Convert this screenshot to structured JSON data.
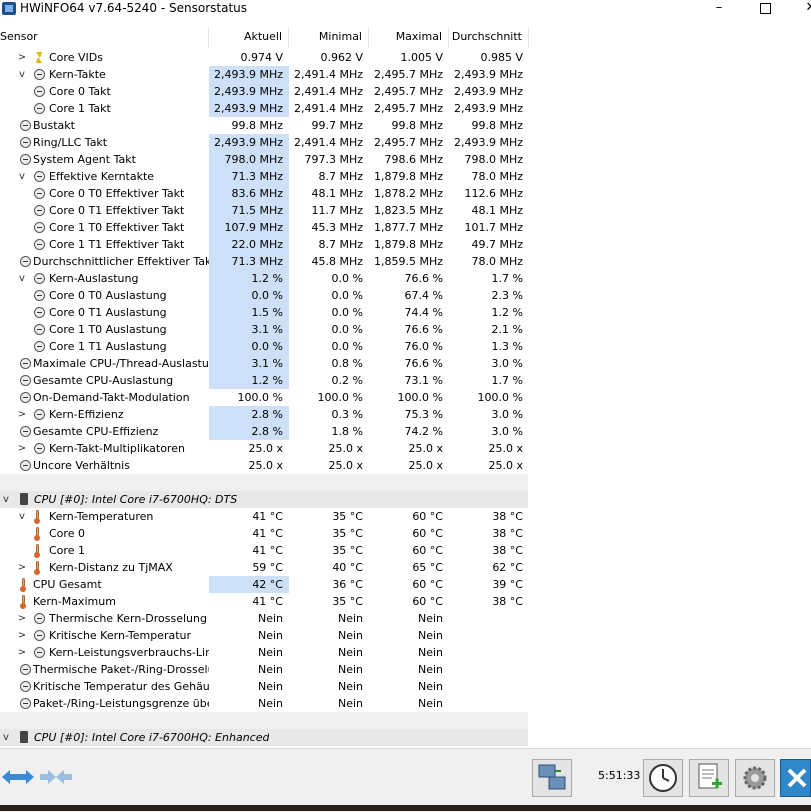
{
  "window": {
    "title": "HWiNFO64 v7.64-5240 - Sensorstatus",
    "controls": [
      "–",
      "□",
      "✕"
    ]
  },
  "header": {
    "sensor": "Sensor",
    "current": "Aktuell",
    "minimum": "Minimal",
    "maximum": "Maximal",
    "average": "Durchschnitt"
  },
  "rows": [
    {
      "label": "Core VIDs",
      "indent": 2,
      "expander": ">",
      "icon": "bolt-icon",
      "cur": "0.974 V",
      "min": "0.962 V",
      "max": "1.005 V",
      "avg": "0.985 V",
      "hl": false
    },
    {
      "label": "Kern-Takte",
      "indent": 2,
      "expander": "v",
      "icon": "clock-icon",
      "cur": "2,493.9 MHz",
      "min": "2,491.4 MHz",
      "max": "2,495.7 MHz",
      "avg": "2,493.9 MHz",
      "hl": true
    },
    {
      "label": "Core 0 Takt",
      "indent": 3,
      "expander": "",
      "icon": "clock-icon",
      "cur": "2,493.9 MHz",
      "min": "2,491.4 MHz",
      "max": "2,495.7 MHz",
      "avg": "2,493.9 MHz",
      "hl": true
    },
    {
      "label": "Core 1 Takt",
      "indent": 3,
      "expander": "",
      "icon": "clock-icon",
      "cur": "2,493.9 MHz",
      "min": "2,491.4 MHz",
      "max": "2,495.7 MHz",
      "avg": "2,493.9 MHz",
      "hl": true
    },
    {
      "label": "Bustakt",
      "indent": 1,
      "expander": "",
      "icon": "clock-icon",
      "cur": "99.8 MHz",
      "min": "99.7 MHz",
      "max": "99.8 MHz",
      "avg": "99.8 MHz",
      "hl": false
    },
    {
      "label": "Ring/LLC Takt",
      "indent": 1,
      "expander": "",
      "icon": "clock-icon",
      "cur": "2,493.9 MHz",
      "min": "2,491.4 MHz",
      "max": "2,495.7 MHz",
      "avg": "2,493.9 MHz",
      "hl": true
    },
    {
      "label": "System Agent Takt",
      "indent": 1,
      "expander": "",
      "icon": "clock-icon",
      "cur": "798.0 MHz",
      "min": "797.3 MHz",
      "max": "798.6 MHz",
      "avg": "798.0 MHz",
      "hl": true
    },
    {
      "label": "Effektive Kerntakte",
      "indent": 2,
      "expander": "v",
      "icon": "clock-icon",
      "cur": "71.3 MHz",
      "min": "8.7 MHz",
      "max": "1,879.8 MHz",
      "avg": "78.0 MHz",
      "hl": true
    },
    {
      "label": "Core 0 T0 Effektiver Takt",
      "indent": 3,
      "expander": "",
      "icon": "clock-icon",
      "cur": "83.6 MHz",
      "min": "48.1 MHz",
      "max": "1,878.2 MHz",
      "avg": "112.6 MHz",
      "hl": true
    },
    {
      "label": "Core 0 T1 Effektiver Takt",
      "indent": 3,
      "expander": "",
      "icon": "clock-icon",
      "cur": "71.5 MHz",
      "min": "11.7 MHz",
      "max": "1,823.5 MHz",
      "avg": "48.1 MHz",
      "hl": true
    },
    {
      "label": "Core 1 T0 Effektiver Takt",
      "indent": 3,
      "expander": "",
      "icon": "clock-icon",
      "cur": "107.9 MHz",
      "min": "45.3 MHz",
      "max": "1,877.7 MHz",
      "avg": "101.7 MHz",
      "hl": true
    },
    {
      "label": "Core 1 T1 Effektiver Takt",
      "indent": 3,
      "expander": "",
      "icon": "clock-icon",
      "cur": "22.0 MHz",
      "min": "8.7 MHz",
      "max": "1,879.8 MHz",
      "avg": "49.7 MHz",
      "hl": true
    },
    {
      "label": "Durchschnittlicher Effektiver Takt",
      "indent": 1,
      "expander": "",
      "icon": "clock-icon",
      "cur": "71.3 MHz",
      "min": "45.8 MHz",
      "max": "1,859.5 MHz",
      "avg": "78.0 MHz",
      "hl": true
    },
    {
      "label": "Kern-Auslastung",
      "indent": 2,
      "expander": "v",
      "icon": "clock-icon",
      "cur": "1.2 %",
      "min": "0.0 %",
      "max": "76.6 %",
      "avg": "1.7 %",
      "hl": true
    },
    {
      "label": "Core 0 T0 Auslastung",
      "indent": 3,
      "expander": "",
      "icon": "clock-icon",
      "cur": "0.0 %",
      "min": "0.0 %",
      "max": "67.4 %",
      "avg": "2.3 %",
      "hl": true
    },
    {
      "label": "Core 0 T1 Auslastung",
      "indent": 3,
      "expander": "",
      "icon": "clock-icon",
      "cur": "1.5 %",
      "min": "0.0 %",
      "max": "74.4 %",
      "avg": "1.2 %",
      "hl": true
    },
    {
      "label": "Core 1 T0 Auslastung",
      "indent": 3,
      "expander": "",
      "icon": "clock-icon",
      "cur": "3.1 %",
      "min": "0.0 %",
      "max": "76.6 %",
      "avg": "2.1 %",
      "hl": true
    },
    {
      "label": "Core 1 T1 Auslastung",
      "indent": 3,
      "expander": "",
      "icon": "clock-icon",
      "cur": "0.0 %",
      "min": "0.0 %",
      "max": "76.0 %",
      "avg": "1.3 %",
      "hl": true
    },
    {
      "label": "Maximale CPU-/Thread-Auslastung",
      "indent": 1,
      "expander": "",
      "icon": "clock-icon",
      "cur": "3.1 %",
      "min": "0.8 %",
      "max": "76.6 %",
      "avg": "3.0 %",
      "hl": true
    },
    {
      "label": "Gesamte CPU-Auslastung",
      "indent": 1,
      "expander": "",
      "icon": "clock-icon",
      "cur": "1.2 %",
      "min": "0.2 %",
      "max": "73.1 %",
      "avg": "1.7 %",
      "hl": true
    },
    {
      "label": "On-Demand-Takt-Modulation",
      "indent": 1,
      "expander": "",
      "icon": "clock-icon",
      "cur": "100.0 %",
      "min": "100.0 %",
      "max": "100.0 %",
      "avg": "100.0 %",
      "hl": false
    },
    {
      "label": "Kern-Effizienz",
      "indent": 2,
      "expander": ">",
      "icon": "clock-icon",
      "cur": "2.8 %",
      "min": "0.3 %",
      "max": "75.3 %",
      "avg": "3.0 %",
      "hl": true
    },
    {
      "label": "Gesamte CPU-Effizienz",
      "indent": 1,
      "expander": "",
      "icon": "clock-icon",
      "cur": "2.8 %",
      "min": "1.8 %",
      "max": "74.2 %",
      "avg": "3.0 %",
      "hl": true
    },
    {
      "label": "Kern-Takt-Multiplikatoren",
      "indent": 2,
      "expander": ">",
      "icon": "clock-icon",
      "cur": "25.0 x",
      "min": "25.0 x",
      "max": "25.0 x",
      "avg": "25.0 x",
      "hl": false
    },
    {
      "label": "Uncore Verhältnis",
      "indent": 1,
      "expander": "",
      "icon": "clock-icon",
      "cur": "25.0 x",
      "min": "25.0 x",
      "max": "25.0 x",
      "avg": "25.0 x",
      "hl": false
    },
    {
      "type": "sep"
    },
    {
      "type": "group",
      "label": "CPU [#0]: Intel Core i7-6700HQ: DTS",
      "expander": "v",
      "icon": "chip-icon"
    },
    {
      "label": "Kern-Temperaturen",
      "indent": 2,
      "expander": "v",
      "icon": "thermometer-icon",
      "cur": "41 °C",
      "min": "35 °C",
      "max": "60 °C",
      "avg": "38 °C",
      "hl": false
    },
    {
      "label": "Core 0",
      "indent": 3,
      "expander": "",
      "icon": "thermometer-icon",
      "cur": "41 °C",
      "min": "35 °C",
      "max": "60 °C",
      "avg": "38 °C",
      "hl": false
    },
    {
      "label": "Core 1",
      "indent": 3,
      "expander": "",
      "icon": "thermometer-icon",
      "cur": "41 °C",
      "min": "35 °C",
      "max": "60 °C",
      "avg": "38 °C",
      "hl": false
    },
    {
      "label": "Kern-Distanz zu TjMAX",
      "indent": 2,
      "expander": ">",
      "icon": "thermometer-icon",
      "cur": "59 °C",
      "min": "40 °C",
      "max": "65 °C",
      "avg": "62 °C",
      "hl": false
    },
    {
      "label": "CPU Gesamt",
      "indent": 1,
      "expander": "",
      "icon": "thermometer-icon",
      "cur": "42 °C",
      "min": "36 °C",
      "max": "60 °C",
      "avg": "39 °C",
      "hl": true
    },
    {
      "label": "Kern-Maximum",
      "indent": 1,
      "expander": "",
      "icon": "thermometer-icon",
      "cur": "41 °C",
      "min": "35 °C",
      "max": "60 °C",
      "avg": "38 °C",
      "hl": false
    },
    {
      "label": "Thermische Kern-Drosselung",
      "indent": 2,
      "expander": ">",
      "icon": "clock-icon",
      "cur": "Nein",
      "min": "Nein",
      "max": "Nein",
      "avg": "",
      "hl": false
    },
    {
      "label": "Kritische Kern-Temperatur",
      "indent": 2,
      "expander": ">",
      "icon": "clock-icon",
      "cur": "Nein",
      "min": "Nein",
      "max": "Nein",
      "avg": "",
      "hl": false
    },
    {
      "label": "Kern-Leistungsverbrauchs-Lim...",
      "indent": 2,
      "expander": ">",
      "icon": "clock-icon",
      "cur": "Nein",
      "min": "Nein",
      "max": "Nein",
      "avg": "",
      "hl": false
    },
    {
      "label": "Thermische Paket-/Ring-Drosselung",
      "indent": 1,
      "expander": "",
      "icon": "clock-icon",
      "cur": "Nein",
      "min": "Nein",
      "max": "Nein",
      "avg": "",
      "hl": false
    },
    {
      "label": "Kritische Temperatur des Gehäus...",
      "indent": 1,
      "expander": "",
      "icon": "clock-icon",
      "cur": "Nein",
      "min": "Nein",
      "max": "Nein",
      "avg": "",
      "hl": false
    },
    {
      "label": "Paket-/Ring-Leistungsgrenze übe...",
      "indent": 1,
      "expander": "",
      "icon": "clock-icon",
      "cur": "Nein",
      "min": "Nein",
      "max": "Nein",
      "avg": "",
      "hl": false
    },
    {
      "type": "sep"
    },
    {
      "type": "group",
      "label": "CPU [#0]: Intel Core i7-6700HQ: Enhanced",
      "expander": "v",
      "icon": "chip-icon"
    }
  ],
  "footer": {
    "clock": "5:51:33"
  },
  "colors": {
    "highlight": "#cde0f7",
    "group_bg": "#e8e8e8",
    "close_blue": "#2f86c8"
  }
}
